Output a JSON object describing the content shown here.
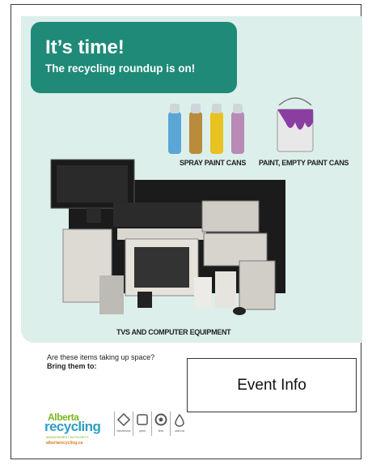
{
  "header": {
    "title": "It’s time!",
    "subtitle": "The recycling roundup is on!"
  },
  "items": {
    "spray_label": "SPRAY PAINT CANS",
    "paint_label": "PAINT, EMPTY PAINT CANS",
    "electronics_label": "TVS AND COMPUTER EQUIPMENT"
  },
  "footer": {
    "question": "Are these items taking up space?",
    "cta": "Bring them to:",
    "event_box": "Event Info"
  },
  "logo": {
    "line1": "Alberta",
    "line2": "recycling",
    "tagline": "MANAGEMENT AUTHORITY",
    "url": "albertarecycling.ca",
    "icon_labels": [
      "electronics",
      "paint",
      "tires",
      "used oil"
    ]
  },
  "colors": {
    "panel": "#dcefeb",
    "headline": "#1f8a78",
    "brand_green": "#7ab51d",
    "brand_blue": "#2e9ec4",
    "brand_orange": "#e07a1b"
  }
}
